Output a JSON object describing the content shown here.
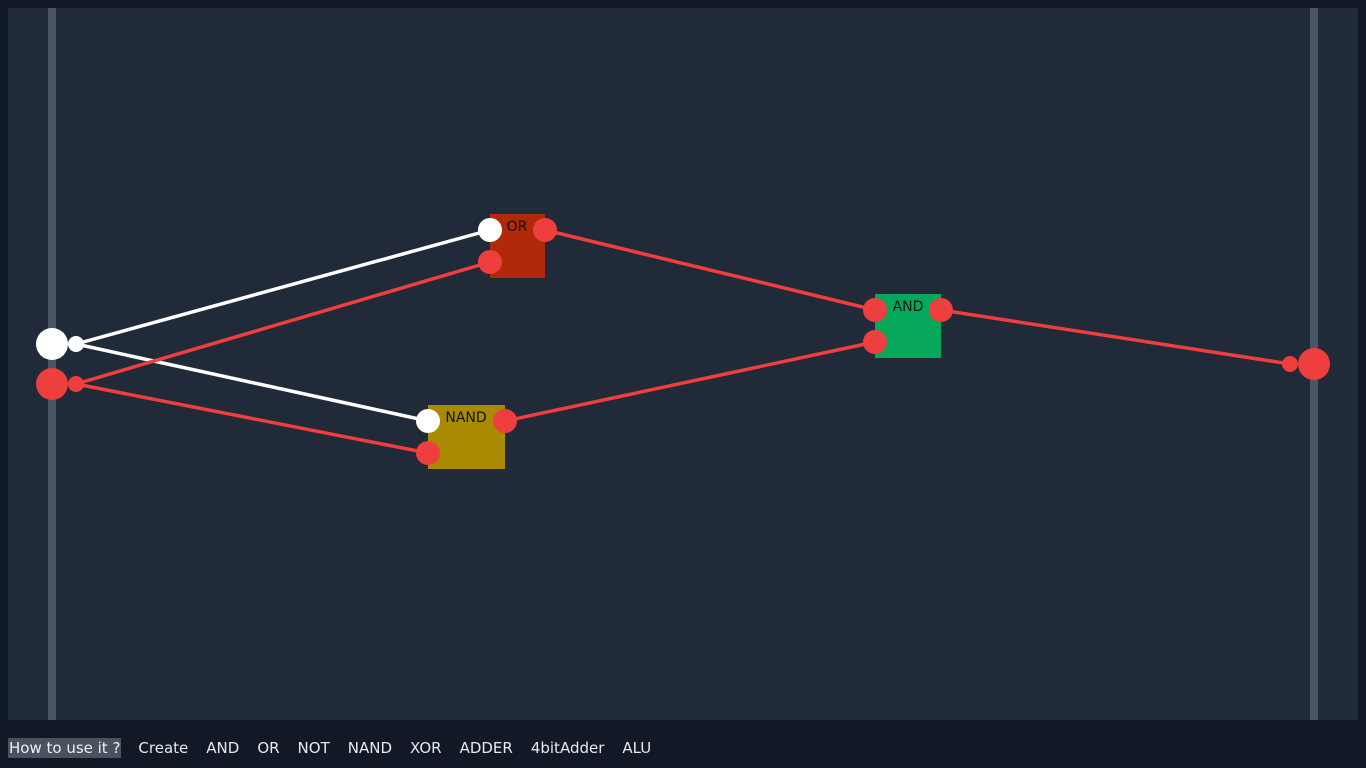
{
  "colors": {
    "background": "#212a38",
    "rail": "#4a5566",
    "signal_on": "#ffffff",
    "signal_off": "#ef3e3e",
    "gate_or": "#b02a0a",
    "gate_and": "#05a85a",
    "gate_nand": "#aa8a00"
  },
  "gates": {
    "or": {
      "label": "OR"
    },
    "and": {
      "label": "AND"
    },
    "nand": {
      "label": "NAND"
    }
  },
  "inputs": [
    {
      "state": "on"
    },
    {
      "state": "off"
    }
  ],
  "output": {
    "state": "off"
  },
  "toolbar": {
    "items": [
      {
        "label": "How to use it ?",
        "active": true
      },
      {
        "label": "Create"
      },
      {
        "label": "AND"
      },
      {
        "label": "OR"
      },
      {
        "label": "NOT"
      },
      {
        "label": "NAND"
      },
      {
        "label": "XOR"
      },
      {
        "label": "ADDER"
      },
      {
        "label": "4bitAdder"
      },
      {
        "label": "ALU"
      }
    ]
  }
}
